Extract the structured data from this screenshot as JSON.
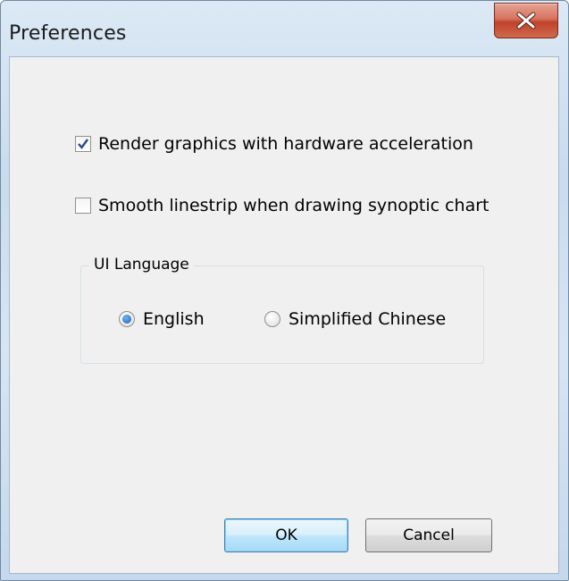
{
  "window": {
    "title": "Preferences",
    "close_icon": "close-icon",
    "accent_colors": {
      "close": "#c0432b",
      "frame": "#c9dbee",
      "default_button": "#3c7fb1"
    }
  },
  "options": {
    "hardware_acceleration": {
      "label": "Render graphics with hardware acceleration",
      "checked": true
    },
    "smooth_linestrip": {
      "label": "Smooth linestrip when drawing synoptic chart",
      "checked": false
    }
  },
  "language_group": {
    "label": "UI Language",
    "options": [
      {
        "label": "English",
        "selected": true
      },
      {
        "label": "Simplified Chinese",
        "selected": false
      }
    ]
  },
  "buttons": {
    "ok": "OK",
    "cancel": "Cancel"
  }
}
